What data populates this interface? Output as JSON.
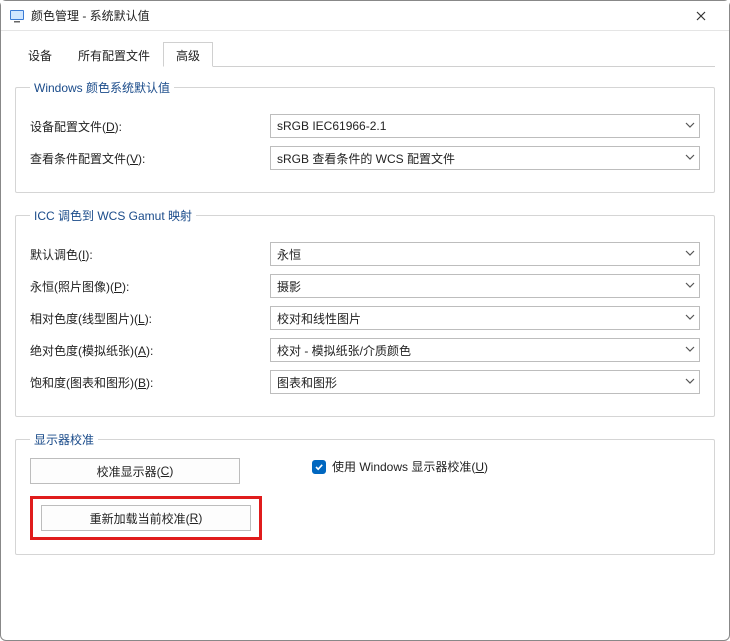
{
  "window": {
    "title": "颜色管理 - 系统默认值"
  },
  "tabs": {
    "devices": "设备",
    "allProfiles": "所有配置文件",
    "advanced": "高级"
  },
  "group_defaults": {
    "legend": "Windows 颜色系统默认值",
    "deviceProfileLabel_pre": "设备配置文件(",
    "deviceProfileLabel_key": "D",
    "deviceProfileLabel_post": "):",
    "deviceProfileValue": "sRGB IEC61966-2.1",
    "viewingProfileLabel_pre": "查看条件配置文件(",
    "viewingProfileLabel_key": "V",
    "viewingProfileLabel_post": "):",
    "viewingProfileValue": "sRGB 查看条件的 WCS 配置文件"
  },
  "group_icc": {
    "legend": "ICC 调色到 WCS Gamut 映射",
    "defaultRenderLabel_pre": "默认调色(",
    "defaultRenderLabel_key": "I",
    "defaultRenderLabel_post": "):",
    "defaultRenderValue": "永恒",
    "perceptualLabel_pre": "永恒(照片图像)(",
    "perceptualLabel_key": "P",
    "perceptualLabel_post": "):",
    "perceptualValue": "摄影",
    "relColorLabel_pre": "相对色度(线型图片)(",
    "relColorLabel_key": "L",
    "relColorLabel_post": "):",
    "relColorValue": "校对和线性图片",
    "absColorLabel_pre": "绝对色度(模拟纸张)(",
    "absColorLabel_key": "A",
    "absColorLabel_post": "):",
    "absColorValue": "校对 - 模拟纸张/介质颜色",
    "saturationLabel_pre": "饱和度(图表和图形)(",
    "saturationLabel_key": "B",
    "saturationLabel_post": "):",
    "saturationValue": "图表和图形"
  },
  "group_calib": {
    "legend": "显示器校准",
    "calibrateBtn_pre": "校准显示器(",
    "calibrateBtn_key": "C",
    "calibrateBtn_post": ")",
    "reloadBtn_pre": "重新加载当前校准(",
    "reloadBtn_key": "R",
    "reloadBtn_post": ")",
    "useWinCalib_pre": "使用 Windows 显示器校准(",
    "useWinCalib_key": "U",
    "useWinCalib_post": ")",
    "useWinCalibChecked": true
  }
}
